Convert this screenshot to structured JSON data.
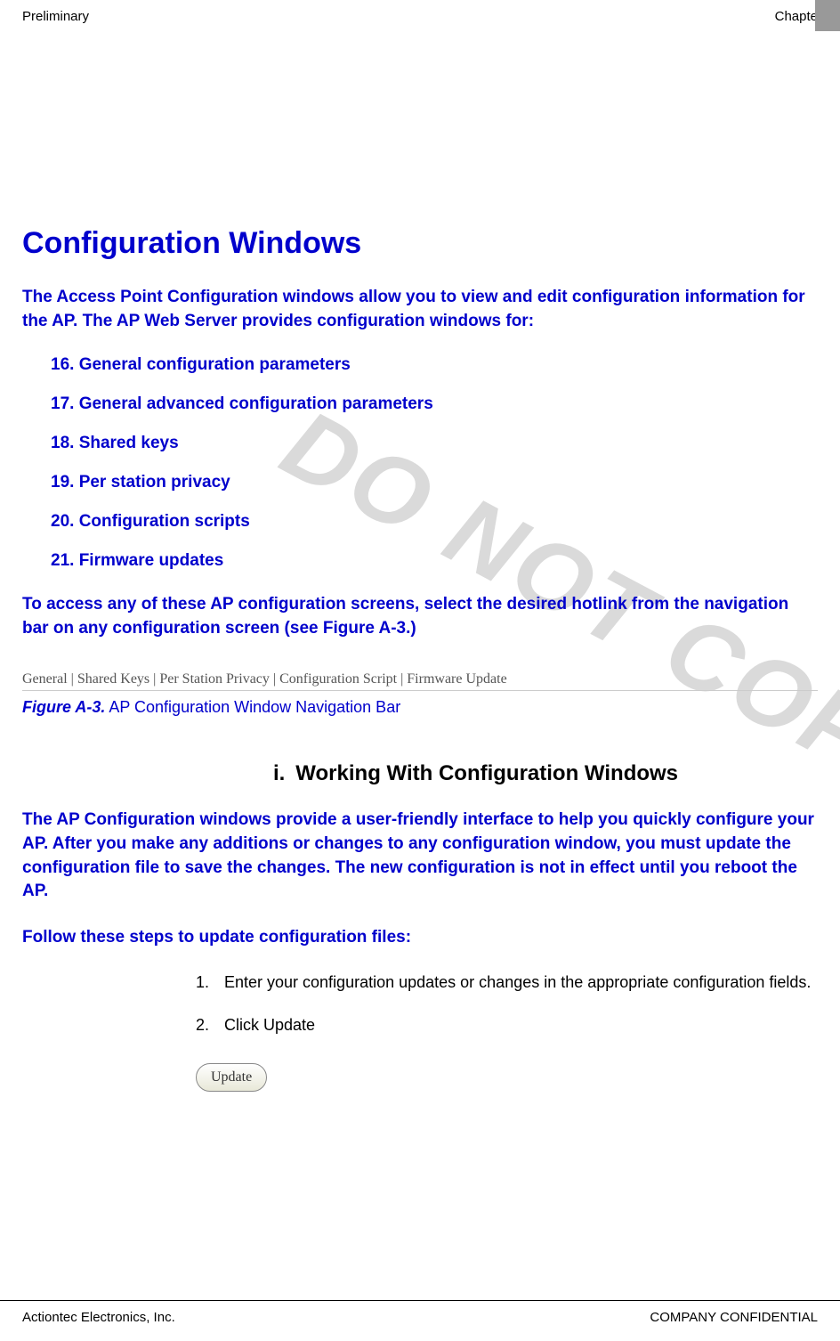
{
  "header": {
    "left": "Preliminary",
    "right": "Chapter"
  },
  "watermark": "DO NOT COPY",
  "main_heading": "Configuration Windows",
  "intro": "The Access Point Configuration windows allow you to view and edit configuration information for the AP. The AP Web Server provides configuration windows for:",
  "list_items": [
    "16. General configuration parameters",
    "17. General advanced configuration parameters",
    "18. Shared keys",
    "19. Per station privacy",
    "20. Configuration scripts",
    "21. Firmware updates"
  ],
  "access_text": "To access any of these AP configuration screens, select the desired hotlink from the navigation bar on any configuration screen (see Figure A-3.)",
  "nav_bar_text": "General | Shared Keys | Per Station Privacy | Configuration Script | Firmware Update",
  "figure": {
    "label": "Figure A-3.",
    "text": " AP Configuration Window Navigation Bar"
  },
  "sub_heading": {
    "num": "i.",
    "text": "Working With Configuration Windows"
  },
  "body_text": "The AP Configuration windows provide a user-friendly interface to help you quickly configure your AP. After you make any additions or changes to any configuration window, you must update the configuration file to save the changes. The new configuration is not in effect until you reboot the AP.",
  "follow_text": "Follow these steps to update configuration files:",
  "steps": [
    {
      "num": "1.",
      "text": "Enter your configuration updates or changes in the appropriate configuration fields."
    },
    {
      "num": "2.",
      "text": "Click Update"
    }
  ],
  "update_button": "Update",
  "footer": {
    "left": "Actiontec Electronics, Inc.",
    "right": "COMPANY CONFIDENTIAL"
  }
}
